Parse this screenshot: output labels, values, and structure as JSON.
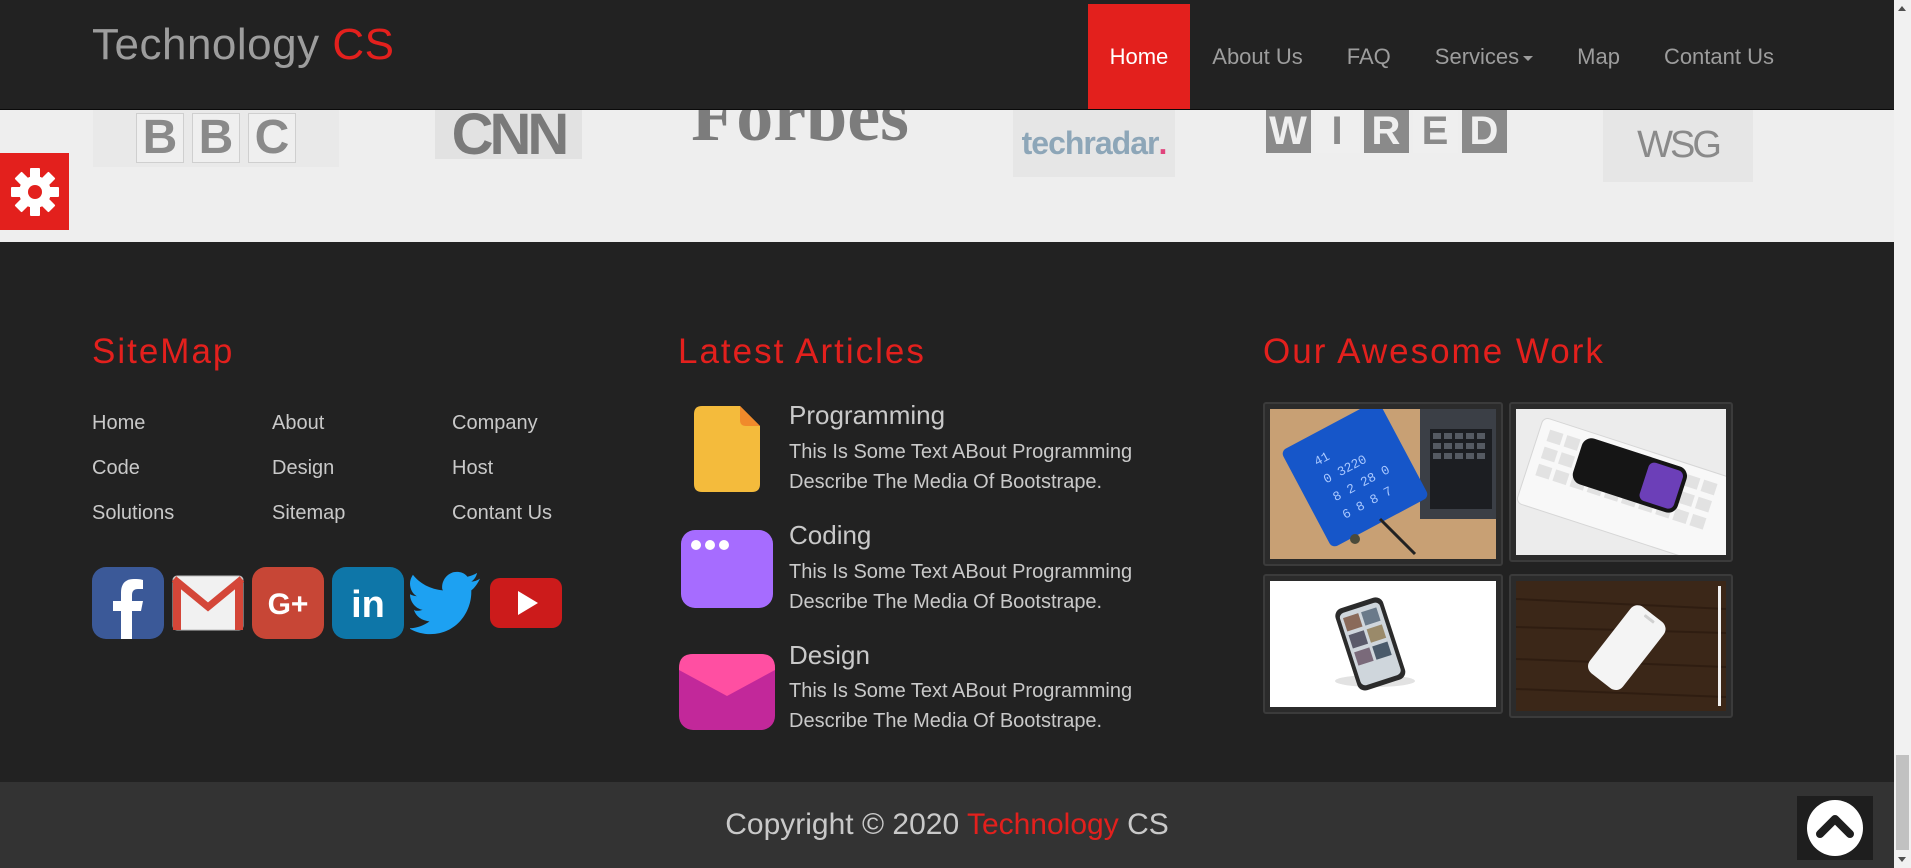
{
  "navbar": {
    "brand_main": "Technology",
    "brand_accent": "CS",
    "items": [
      {
        "label": "Home",
        "active": true
      },
      {
        "label": "About Us"
      },
      {
        "label": "FAQ"
      },
      {
        "label": "Services",
        "dropdown": true
      },
      {
        "label": "Map"
      },
      {
        "label": "Contant Us"
      }
    ]
  },
  "logos": {
    "bbc": [
      "B",
      "B",
      "C"
    ],
    "cnn": "CNN",
    "forbes": "Forbes",
    "techradar": {
      "text": "techradar",
      "dot": "."
    },
    "wired": [
      "W",
      "I",
      "R",
      "E",
      "D"
    ],
    "wsg": "WSG"
  },
  "settings": {
    "icon": "gear-icon"
  },
  "footer": {
    "sitemap": {
      "title": "SiteMap",
      "links": [
        "Home",
        "About",
        "Company",
        "Code",
        "Design",
        "Host",
        "Solutions",
        "Sitemap",
        "Contant Us"
      ],
      "social": [
        "facebook-icon",
        "gmail-icon",
        "google-plus-icon",
        "linkedin-icon",
        "twitter-icon",
        "youtube-icon"
      ]
    },
    "articles": {
      "title": "Latest Articles",
      "items": [
        {
          "title": "Programming",
          "text": "This Is Some Text ABout Programming Describe The Media Of Bootstrape.",
          "icon": "document-icon"
        },
        {
          "title": "Coding",
          "text": "This Is Some Text ABout Programming Describe The Media Of Bootstrape.",
          "icon": "window-icon"
        },
        {
          "title": "Design",
          "text": "This Is Some Text ABout Programming Describe The Media Of Bootstrape.",
          "icon": "envelope-icon"
        }
      ]
    },
    "work": {
      "title": "Our Awesome Work"
    }
  },
  "copyright": {
    "prefix": "Copyright © 2020",
    "brand_accent": "Technology",
    "brand_suffix": "CS"
  },
  "colors": {
    "accent": "#e3201d",
    "background": "#222222",
    "text": "#c9c9c9"
  }
}
